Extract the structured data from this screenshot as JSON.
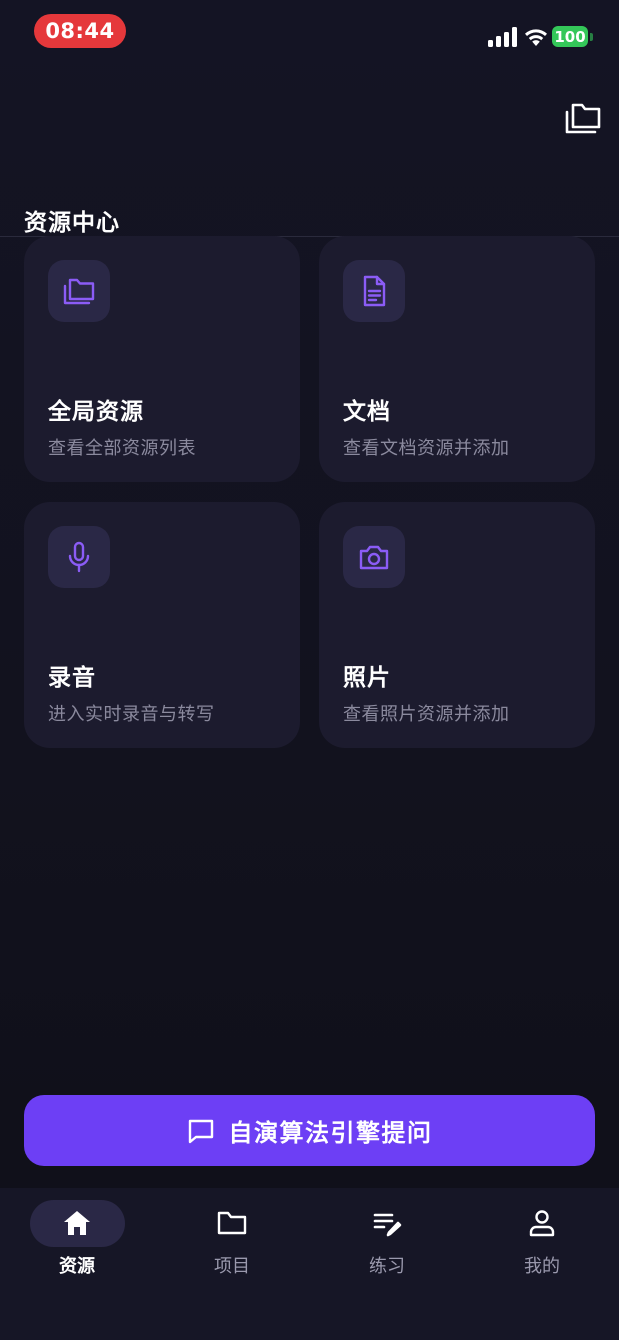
{
  "status_bar": {
    "time": "08:44",
    "battery": "100"
  },
  "header": {
    "title": "资源中心",
    "action_icon": "folders-icon"
  },
  "cards": [
    {
      "title": "全局资源",
      "subtitle": "查看全部资源列表",
      "icon": "folders-icon"
    },
    {
      "title": "文档",
      "subtitle": "查看文档资源并添加",
      "icon": "document-icon"
    },
    {
      "title": "录音",
      "subtitle": "进入实时录音与转写",
      "icon": "microphone-icon"
    },
    {
      "title": "照片",
      "subtitle": "查看照片资源并添加",
      "icon": "camera-icon"
    }
  ],
  "ask_button": {
    "label": "自演算法引擎提问",
    "icon": "chat-bubble-icon"
  },
  "bottom_nav": {
    "items": [
      {
        "label": "资源",
        "icon": "home-icon",
        "active": true
      },
      {
        "label": "项目",
        "icon": "folder-icon",
        "active": false
      },
      {
        "label": "练习",
        "icon": "edit-list-icon",
        "active": false
      },
      {
        "label": "我的",
        "icon": "user-icon",
        "active": false
      }
    ]
  },
  "colors": {
    "accent": "#6d3ff5",
    "icon_accent": "#8b5cf6",
    "card_bg": "#1c1b2e",
    "battery": "#34c759",
    "time_pill": "#e5383b"
  }
}
